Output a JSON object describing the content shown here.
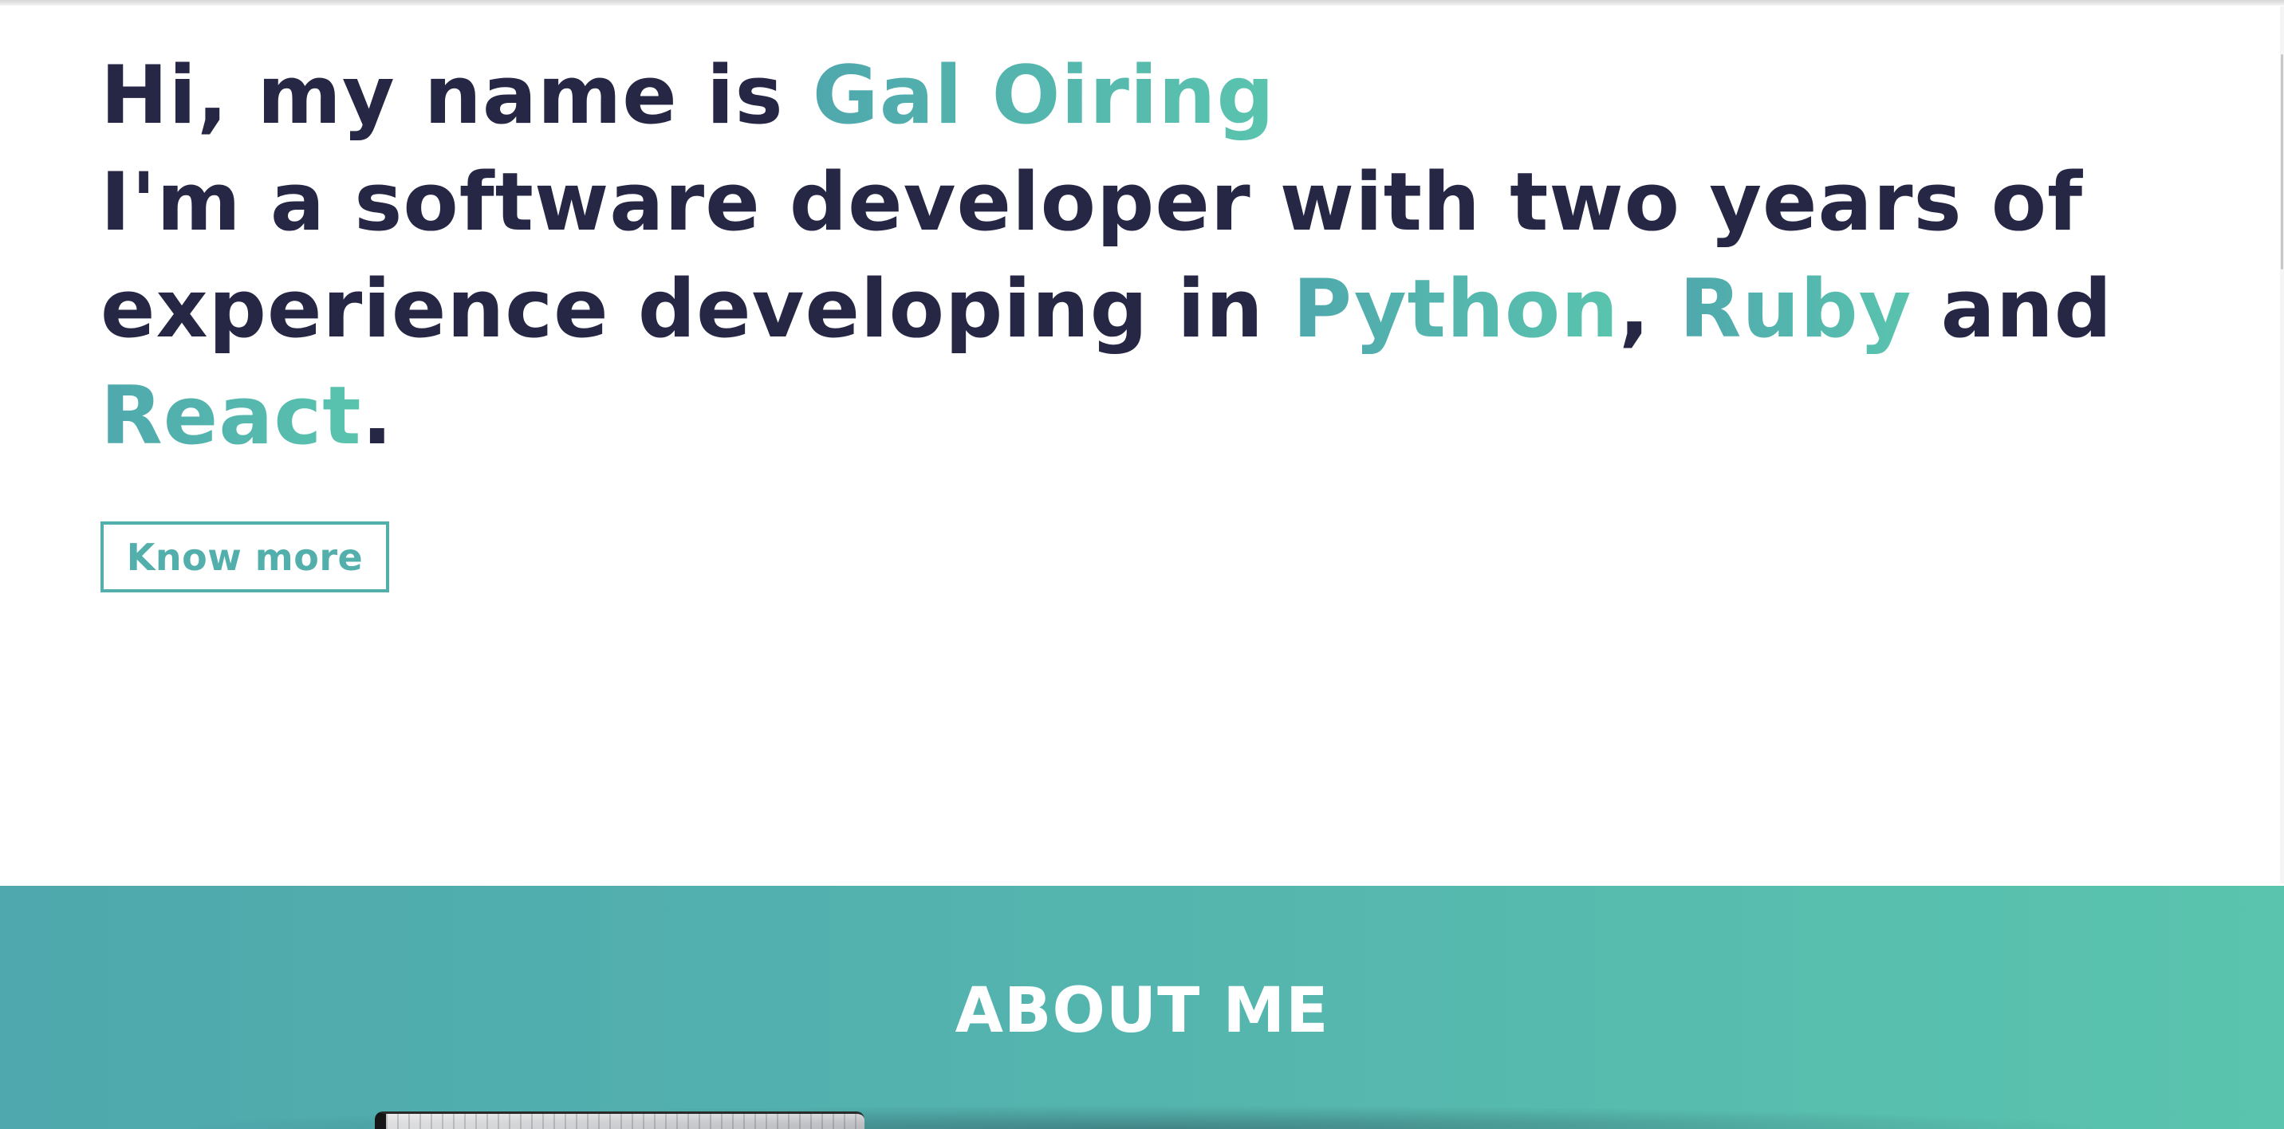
{
  "hero": {
    "greeting_prefix": "Hi, my name is ",
    "name": "Gal Oiring",
    "line2": "I'm a software developer with two years of",
    "line3_prefix": "experience developing in ",
    "skill_1": "Python",
    "separator": ", ",
    "skill_2": "Ruby",
    "connector": " and",
    "skill_3": "React",
    "period": ".",
    "cta_label": "Know more"
  },
  "about": {
    "title": "ABOUT ME"
  },
  "colors": {
    "text": "#262645",
    "accent_start": "#4fa8ad",
    "accent_end": "#5ac4ae",
    "background": "#ffffff"
  }
}
